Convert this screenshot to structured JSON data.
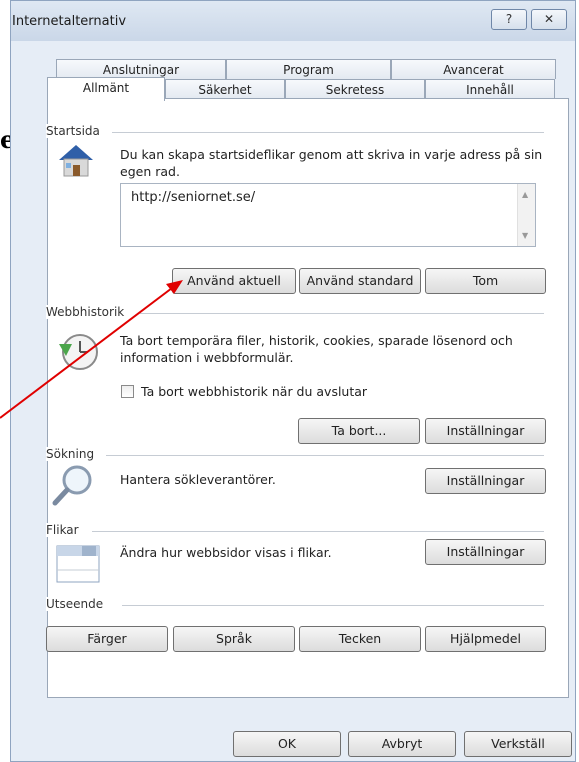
{
  "background_text": "en",
  "window": {
    "title": "Internetalternativ",
    "help_symbol": "?",
    "close_symbol": "✕"
  },
  "tabs_back": [
    "Anslutningar",
    "Program",
    "Avancerat"
  ],
  "tabs_front": [
    "Allmänt",
    "Säkerhet",
    "Sekretess",
    "Innehåll"
  ],
  "startsida": {
    "group_label": "Startsida",
    "description": "Du kan skapa startsideflikar genom att skriva in varje adress på sin egen rad.",
    "url_value": "http://seniornet.se/",
    "buttons": {
      "current": "Använd aktuell",
      "standard": "Använd standard",
      "blank": "Tom"
    }
  },
  "webbhistorik": {
    "group_label": "Webbhistorik",
    "description": "Ta bort temporära filer, historik, cookies, sparade lösenord och information i webbformulär.",
    "checkbox_label": "Ta bort webbhistorik när du avslutar",
    "buttons": {
      "delete": "Ta bort...",
      "settings": "Inställningar"
    }
  },
  "sokning": {
    "group_label": "Sökning",
    "description": "Hantera sökleverantörer.",
    "settings": "Inställningar"
  },
  "flikar": {
    "group_label": "Flikar",
    "description": "Ändra hur webbsidor visas i flikar.",
    "settings": "Inställningar"
  },
  "utseende": {
    "group_label": "Utseende",
    "buttons": [
      "Färger",
      "Språk",
      "Tecken",
      "Hjälpmedel"
    ]
  },
  "footer": {
    "ok": "OK",
    "cancel": "Avbryt",
    "apply": "Verkställ"
  },
  "colors": {
    "annotation_arrow": "#e00000",
    "dialog_bg": "#e6edf6"
  }
}
